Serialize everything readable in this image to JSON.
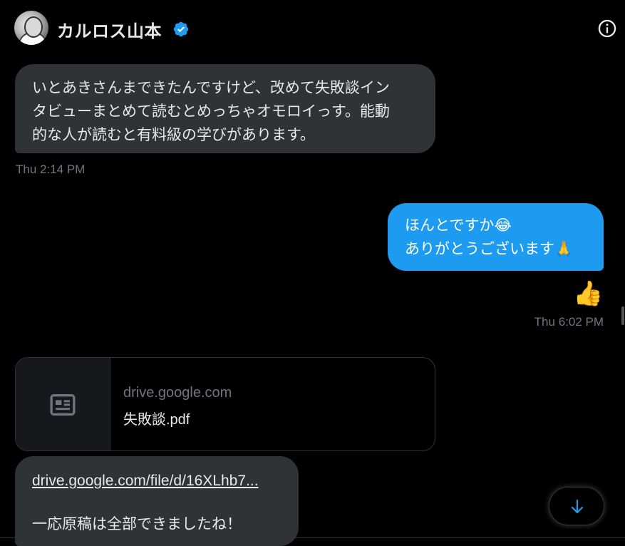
{
  "header": {
    "name": "カルロス山本",
    "verified_icon": "verified-badge-icon",
    "info_icon": "info-icon"
  },
  "messages": [
    {
      "direction": "incoming",
      "text": "いとあきさんまできたんですけど、改めて失敗談インタビューまとめて読むとめっちゃオモロイっす。能動的な人が読むと有料級の学びがあります。",
      "lines": [
        "いとあきさんまできたんですけど、改めて失敗談イン",
        "タビューまとめて読むとめっちゃオモロイっす。能動",
        "的な人が読むと有料級の学びがあります。"
      ],
      "timestamp": "Thu 2:14 PM"
    },
    {
      "direction": "outgoing",
      "lines": [
        "ほんとですか😂",
        "ありがとうございます🙏"
      ],
      "reaction": "👍",
      "timestamp": "Thu 6:02 PM"
    }
  ],
  "link_card": {
    "domain": "drive.google.com",
    "title": "失敗談.pdf",
    "icon": "news-article-icon"
  },
  "message3": {
    "link": "drive.google.com/file/d/16XLhb7...",
    "text": "一応原稿は全部できましたね！"
  },
  "scroll_button": {
    "icon": "arrow-down-icon"
  },
  "colors": {
    "background": "#000000",
    "incoming_bubble": "#2f3336",
    "outgoing_bubble": "#1d9bf0",
    "muted_text": "#71767b",
    "accent": "#1d9bf0"
  }
}
